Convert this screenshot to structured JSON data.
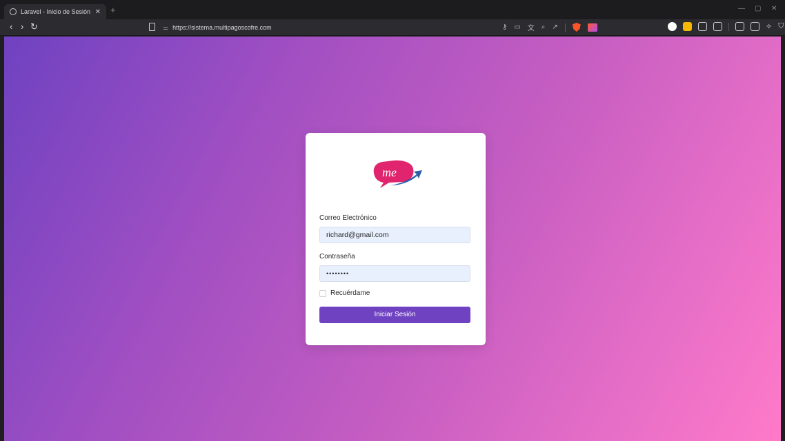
{
  "browser": {
    "tab_title": "Laravel - Inicio de Sesión",
    "url": "https://sistema.multipagoscofre.com"
  },
  "login": {
    "logo_text": "me",
    "logo_colors": {
      "bubble": "#e0246d",
      "arrow": "#2b5fa8"
    },
    "email_label": "Correo Electrónico",
    "email_value": "richard@gmail.com",
    "password_label": "Contraseña",
    "password_mask": "••••••••",
    "remember_label": "Recuérdame",
    "submit_label": "Iniciar Sesión"
  },
  "colors": {
    "accent": "#6f42c1",
    "gradient_start": "#6f42c1",
    "gradient_end": "#ff7ac8",
    "input_bg": "#e8f0fe"
  }
}
